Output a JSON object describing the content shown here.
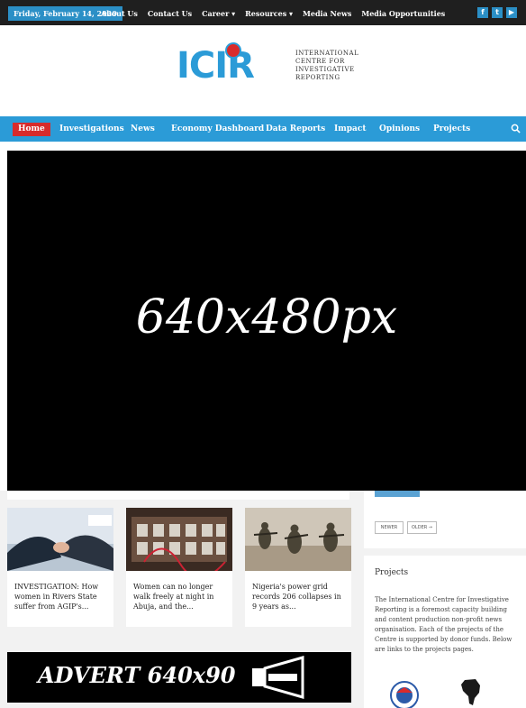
{
  "topbar": {
    "date": "Friday, February 14, 2020",
    "menu": [
      "About Us",
      "Contact Us",
      "Career ▾",
      "Resources ▾",
      "Media News",
      "Media Opportunities"
    ],
    "social_icons": [
      "facebook-icon",
      "twitter-icon",
      "youtube-icon"
    ]
  },
  "brand": {
    "logo_text": "ICIR",
    "tagline": "INTERNATIONAL CENTRE FOR INVESTIGATIVE REPORTING",
    "colors": {
      "blue": "#2b9bd7",
      "red": "#d82b2b"
    }
  },
  "nav": {
    "items": [
      "Home",
      "Investigations",
      "News",
      "Economy Dashboard",
      "Data Reports",
      "Impact",
      "Opinions",
      "Projects"
    ],
    "active": "Home",
    "search_icon": "search-icon"
  },
  "hero": {
    "placeholder_text": "640x480px"
  },
  "cards": [
    {
      "title": "INVESTIGATION: How women in Rivers State suffer from AGIP's..."
    },
    {
      "title": "Women can no longer walk freely at night in Abuja, and the..."
    },
    {
      "title": "Nigeria's power grid records 206 collapses in 9 years as..."
    }
  ],
  "advert": {
    "text": "ADVERT 640x90",
    "icon": "megaphone-icon"
  },
  "sidebar": {
    "buttons": [
      "NEWER",
      "OLDER →"
    ],
    "projects_title": "Projects",
    "projects_text": "The International Centre for Investigative Reporting is a foremost capacity building and content production non-profit news organisation. Each of the projects of the Centre is supported by donor funds. Below are links to the projects pages."
  }
}
